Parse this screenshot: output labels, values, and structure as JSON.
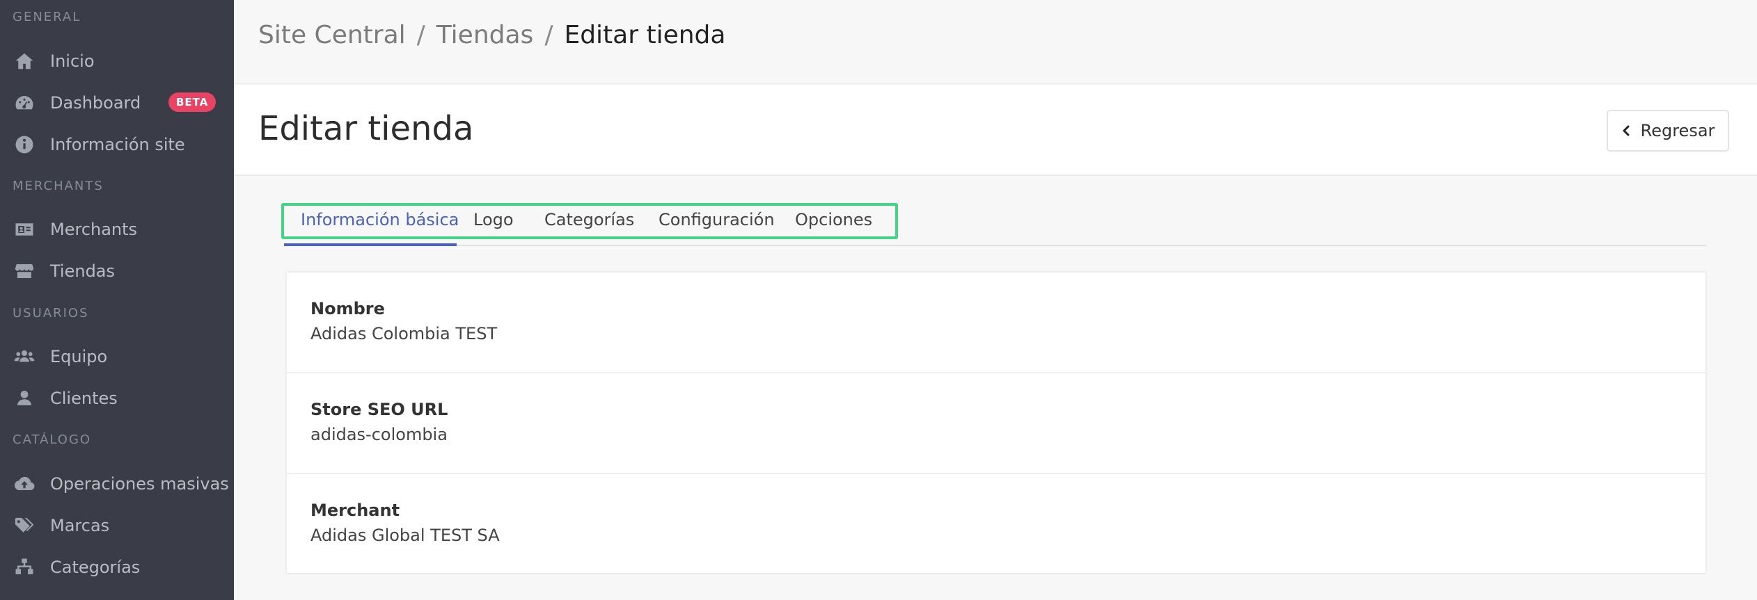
{
  "sidebar": {
    "sections": [
      {
        "label": "GENERAL"
      },
      {
        "label": "MERCHANTS"
      },
      {
        "label": "USUARIOS"
      },
      {
        "label": "CATÁLOGO"
      }
    ],
    "items": [
      {
        "label": "Inicio",
        "icon": "home-icon"
      },
      {
        "label": "Dashboard",
        "icon": "gauge-icon",
        "badge": "BETA"
      },
      {
        "label": "Información site",
        "icon": "info-icon"
      },
      {
        "label": "Merchants",
        "icon": "id-card-icon"
      },
      {
        "label": "Tiendas",
        "icon": "store-icon"
      },
      {
        "label": "Equipo",
        "icon": "users-icon"
      },
      {
        "label": "Clientes",
        "icon": "user-icon"
      },
      {
        "label": "Operaciones masivas",
        "icon": "cloud-upload-icon"
      },
      {
        "label": "Marcas",
        "icon": "tags-icon"
      },
      {
        "label": "Categorías",
        "icon": "sitemap-icon"
      }
    ]
  },
  "breadcrumb": {
    "items": [
      "Site Central",
      "Tiendas"
    ],
    "separator": "/",
    "current": "Editar tienda"
  },
  "header": {
    "title": "Editar tienda",
    "back_label": "Regresar"
  },
  "tabs": [
    {
      "label": "Información básica",
      "active": true
    },
    {
      "label": "Logo"
    },
    {
      "label": "Categorías"
    },
    {
      "label": "Configuración"
    },
    {
      "label": "Opciones"
    }
  ],
  "fields": [
    {
      "label": "Nombre",
      "value": "Adidas Colombia TEST"
    },
    {
      "label": "Store SEO URL",
      "value": "adidas-colombia"
    },
    {
      "label": "Merchant",
      "value": "Adidas Global TEST SA"
    }
  ],
  "colors": {
    "sidebar_bg": "#3a3d47",
    "accent": "#4a63b8",
    "badge": "#e84264",
    "highlight": "#43d486"
  }
}
